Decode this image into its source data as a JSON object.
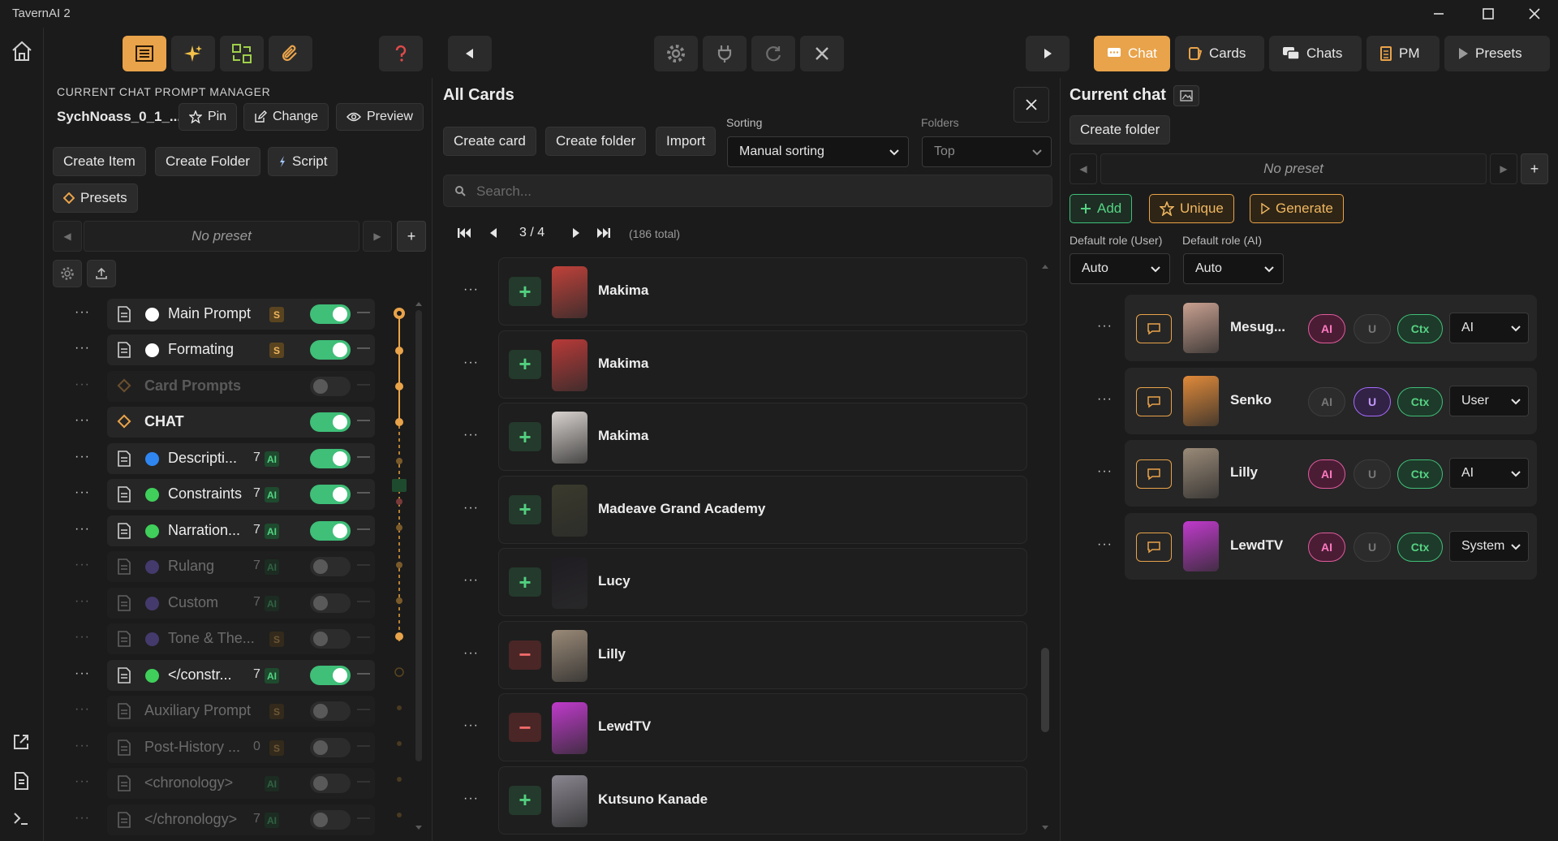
{
  "window": {
    "title": "TavernAI 2"
  },
  "tabs": [
    "Chat",
    "Cards",
    "Chats",
    "PM",
    "Presets"
  ],
  "prompt_manager": {
    "heading": "CURRENT CHAT PROMPT MANAGER",
    "current_name": "SychNoass_0_1_...",
    "pin_label": "Pin",
    "change_label": "Change",
    "preview_label": "Preview",
    "create_item_label": "Create Item",
    "create_folder_label": "Create Folder",
    "script_label": "Script",
    "presets_label": "Presets",
    "no_preset": "No preset",
    "items": [
      {
        "label": "Main Prompt",
        "dot": "#ffffff",
        "num": "",
        "badge": "S",
        "enabled": true,
        "kind": "doc"
      },
      {
        "label": "Formating",
        "dot": "#ffffff",
        "num": "",
        "badge": "S",
        "enabled": true,
        "kind": "doc"
      },
      {
        "label": "Card Prompts",
        "dot": "",
        "num": "",
        "badge": "",
        "enabled": false,
        "kind": "folder"
      },
      {
        "label": "CHAT",
        "dot": "",
        "num": "",
        "badge": "",
        "enabled": true,
        "kind": "folder"
      },
      {
        "label": "Descripti...",
        "dot": "#2f86f0",
        "num": "7",
        "badge": "AI",
        "enabled": true,
        "kind": "doc"
      },
      {
        "label": "Constraints",
        "dot": "#3fcf5a",
        "num": "7",
        "badge": "AI",
        "enabled": true,
        "kind": "doc"
      },
      {
        "label": "Narration...",
        "dot": "#3fcf5a",
        "num": "7",
        "badge": "AI",
        "enabled": true,
        "kind": "doc"
      },
      {
        "label": "Rulang",
        "dot": "#8a6cf0",
        "num": "7",
        "badge": "AI",
        "enabled": false,
        "kind": "doc"
      },
      {
        "label": "Custom",
        "dot": "#8a6cf0",
        "num": "7",
        "badge": "AI",
        "enabled": false,
        "kind": "doc"
      },
      {
        "label": "Tone & The...",
        "dot": "#8a6cf0",
        "num": "",
        "badge": "S",
        "enabled": false,
        "kind": "doc"
      },
      {
        "label": "</constr...",
        "dot": "#3fcf5a",
        "num": "7",
        "badge": "AI",
        "enabled": true,
        "kind": "doc"
      },
      {
        "label": "Auxiliary Prompt",
        "dot": "",
        "num": "",
        "badge": "S",
        "enabled": false,
        "kind": "doc"
      },
      {
        "label": "Post-History ...",
        "dot": "",
        "num": "0",
        "badge": "S",
        "enabled": false,
        "kind": "doc"
      },
      {
        "label": "<chronology>",
        "dot": "",
        "num": "",
        "badge": "AI",
        "enabled": false,
        "kind": "doc"
      },
      {
        "label": "</chronology>",
        "dot": "",
        "num": "7",
        "badge": "AI",
        "enabled": false,
        "kind": "doc"
      }
    ]
  },
  "cards": {
    "heading": "All Cards",
    "create_card_label": "Create card",
    "create_folder_label": "Create folder",
    "import_label": "Import",
    "sorting_label": "Sorting",
    "sorting_value": "Manual sorting",
    "folders_label": "Folders",
    "folders_value": "Top",
    "search_placeholder": "Search...",
    "page": "3 / 4",
    "total": "(186 total)",
    "list": [
      {
        "name": "Makima",
        "action": "add",
        "color": "#c0413a"
      },
      {
        "name": "Makima",
        "action": "add",
        "color": "#b83a38"
      },
      {
        "name": "Makima",
        "action": "add",
        "color": "#d9d3cf"
      },
      {
        "name": "Madeave Grand Academy",
        "action": "add",
        "color": "#3a3a2c"
      },
      {
        "name": "Lucy",
        "action": "add",
        "color": "#1f1c22"
      },
      {
        "name": "Lilly",
        "action": "remove",
        "color": "#9a8a78"
      },
      {
        "name": "LewdTV",
        "action": "remove",
        "color": "#c03acc"
      },
      {
        "name": "Kutsuno Kanade",
        "action": "add",
        "color": "#8a8690"
      }
    ]
  },
  "current_chat": {
    "heading": "Current chat",
    "create_folder_label": "Create folder",
    "no_preset": "No preset",
    "add_label": "Add",
    "unique_label": "Unique",
    "generate_label": "Generate",
    "default_role_user_label": "Default role (User)",
    "default_role_user_value": "Auto",
    "default_role_ai_label": "Default role (AI)",
    "default_role_ai_value": "Auto",
    "participants": [
      {
        "name": "Mesug...",
        "ai": true,
        "u": false,
        "ctx": true,
        "role": "AI",
        "color": "#c8a090"
      },
      {
        "name": "Senko",
        "ai": false,
        "u": true,
        "ctx": true,
        "role": "User",
        "color": "#e08a3a"
      },
      {
        "name": "Lilly",
        "ai": true,
        "u": false,
        "ctx": true,
        "role": "AI",
        "color": "#9a8a78"
      },
      {
        "name": "LewdTV",
        "ai": true,
        "u": false,
        "ctx": true,
        "role": "System",
        "color": "#c03acc"
      }
    ],
    "pill_labels": {
      "ai": "AI",
      "u": "U",
      "ctx": "Ctx"
    }
  },
  "colors": {
    "accent": "#e9a34a",
    "green": "#3fbf78",
    "pink": "#e05a9c",
    "purple": "#a66cff"
  }
}
